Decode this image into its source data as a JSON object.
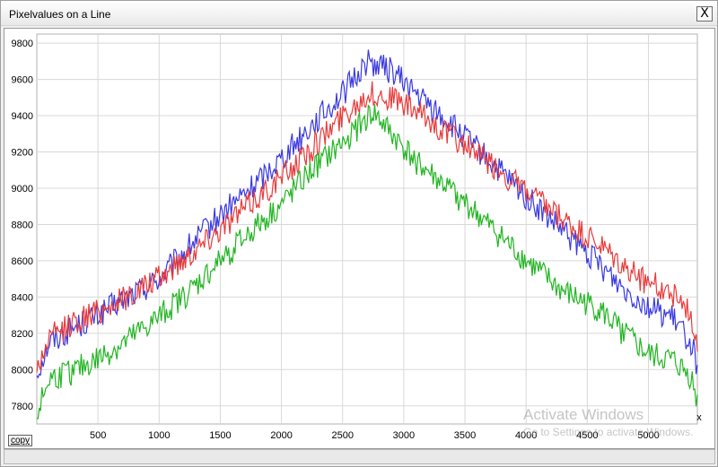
{
  "window": {
    "title": "Pixelvalues on a Line",
    "close_label": "X"
  },
  "toolbar": {
    "copy_label": "copy"
  },
  "watermark": {
    "title": "Activate Windows",
    "subtitle": "Go to Settings to activate Windows."
  },
  "chart_data": {
    "type": "line",
    "title": "",
    "xlabel": "",
    "ylabel": "",
    "x_axis_marker": "x",
    "xlim": [
      0,
      5400
    ],
    "ylim": [
      7700,
      9850
    ],
    "xticks": [
      500,
      1000,
      1500,
      2000,
      2500,
      3000,
      3500,
      4000,
      4500,
      5000
    ],
    "yticks": [
      7800,
      8000,
      8200,
      8400,
      8600,
      8800,
      9000,
      9200,
      9400,
      9600,
      9800
    ],
    "grid": true,
    "legend": "none",
    "series": [
      {
        "color": "#3a3ae0",
        "x": [
          0,
          100,
          300,
          500,
          700,
          1000,
          1250,
          1500,
          1750,
          2000,
          2250,
          2500,
          2700,
          2900,
          3100,
          3500,
          4000,
          4300,
          4600,
          4800,
          5000,
          5200,
          5350,
          5400
        ],
        "y": [
          7980,
          8150,
          8230,
          8300,
          8380,
          8500,
          8680,
          8850,
          9000,
          9170,
          9350,
          9520,
          9700,
          9650,
          9520,
          9280,
          8950,
          8760,
          8580,
          8450,
          8350,
          8280,
          8150,
          8020
        ]
      },
      {
        "color": "#e83a3a",
        "x": [
          0,
          100,
          300,
          500,
          700,
          1000,
          1250,
          1500,
          1750,
          2000,
          2250,
          2500,
          2700,
          2900,
          3100,
          3500,
          4000,
          4300,
          4600,
          4800,
          5000,
          5200,
          5350,
          5400
        ],
        "y": [
          8000,
          8170,
          8260,
          8320,
          8390,
          8500,
          8640,
          8780,
          8920,
          9060,
          9220,
          9400,
          9520,
          9500,
          9420,
          9240,
          8980,
          8820,
          8680,
          8560,
          8480,
          8420,
          8300,
          8150
        ]
      },
      {
        "color": "#22b522",
        "x": [
          0,
          100,
          300,
          500,
          700,
          1000,
          1250,
          1500,
          1750,
          2000,
          2250,
          2500,
          2750,
          2900,
          3100,
          3500,
          4000,
          4300,
          4600,
          4800,
          5000,
          5200,
          5350,
          5400
        ],
        "y": [
          7750,
          7950,
          7990,
          8060,
          8140,
          8290,
          8430,
          8600,
          8760,
          8910,
          9100,
          9250,
          9420,
          9300,
          9150,
          8920,
          8600,
          8430,
          8330,
          8200,
          8080,
          8050,
          7960,
          7820
        ]
      }
    ]
  }
}
